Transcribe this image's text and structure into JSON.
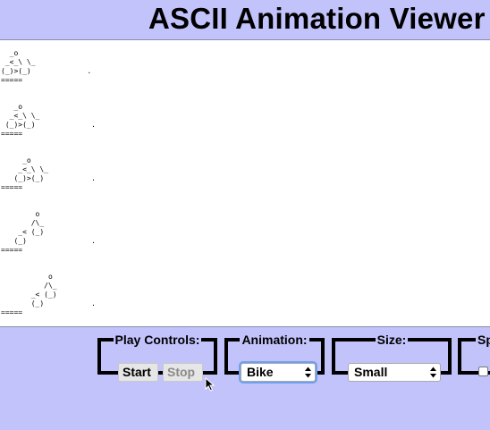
{
  "header": {
    "title": "ASCII Animation Viewer"
  },
  "viewer": {
    "ascii_text": "  _o\n _<_\\ \\_\n(_)>(_)             .\n=====\n\n\n   _o\n  _<_\\ \\_\n (_)>(_)             .\n=====\n\n\n     _o\n    _<_\\ \\_\n   (_)>(_)           .\n=====\n\n\n        o\n       /\\_\n    _< (_)\n   (_)               .\n=====\n\n\n           o\n          /\\_\n       _< (_)\n       (_)           .\n=====\n\n\n            \\\\\\o"
  },
  "controls": {
    "play": {
      "legend": "Play Controls:",
      "start_label": "Start",
      "stop_label": "Stop"
    },
    "animation": {
      "legend": "Animation:",
      "selected": "Bike"
    },
    "size": {
      "legend": "Size:",
      "selected": "Small"
    },
    "speed": {
      "legend": "Sp"
    }
  },
  "colors": {
    "page_background": "#c3c3fc",
    "viewer_background": "#ffffff",
    "focus_ring": "#6ea0f0"
  }
}
